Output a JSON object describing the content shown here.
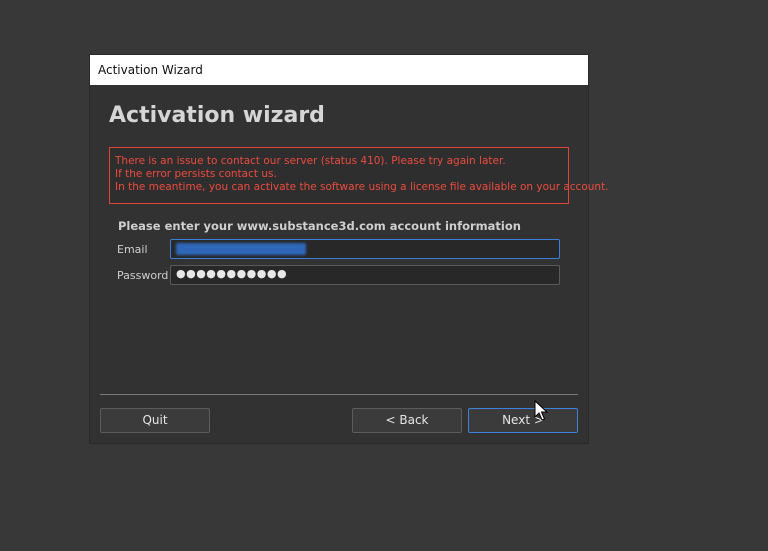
{
  "window": {
    "title": "Activation Wizard"
  },
  "wizard": {
    "heading": "Activation wizard",
    "error_lines": [
      "There is an issue to contact our server (status 410). Please try again later.",
      "If the error persists contact us.",
      "In the meantime, you can activate the software using a license file available on your account."
    ],
    "prompt": "Please enter your www.substance3d.com account information",
    "email_label": "Email",
    "password_label": "Password",
    "password_value": "●●●●●●●●●●●"
  },
  "buttons": {
    "quit": "Quit",
    "back": "< Back",
    "next": "Next >"
  },
  "colors": {
    "error": "#ec4b3f",
    "focus": "#3c7fd6"
  }
}
